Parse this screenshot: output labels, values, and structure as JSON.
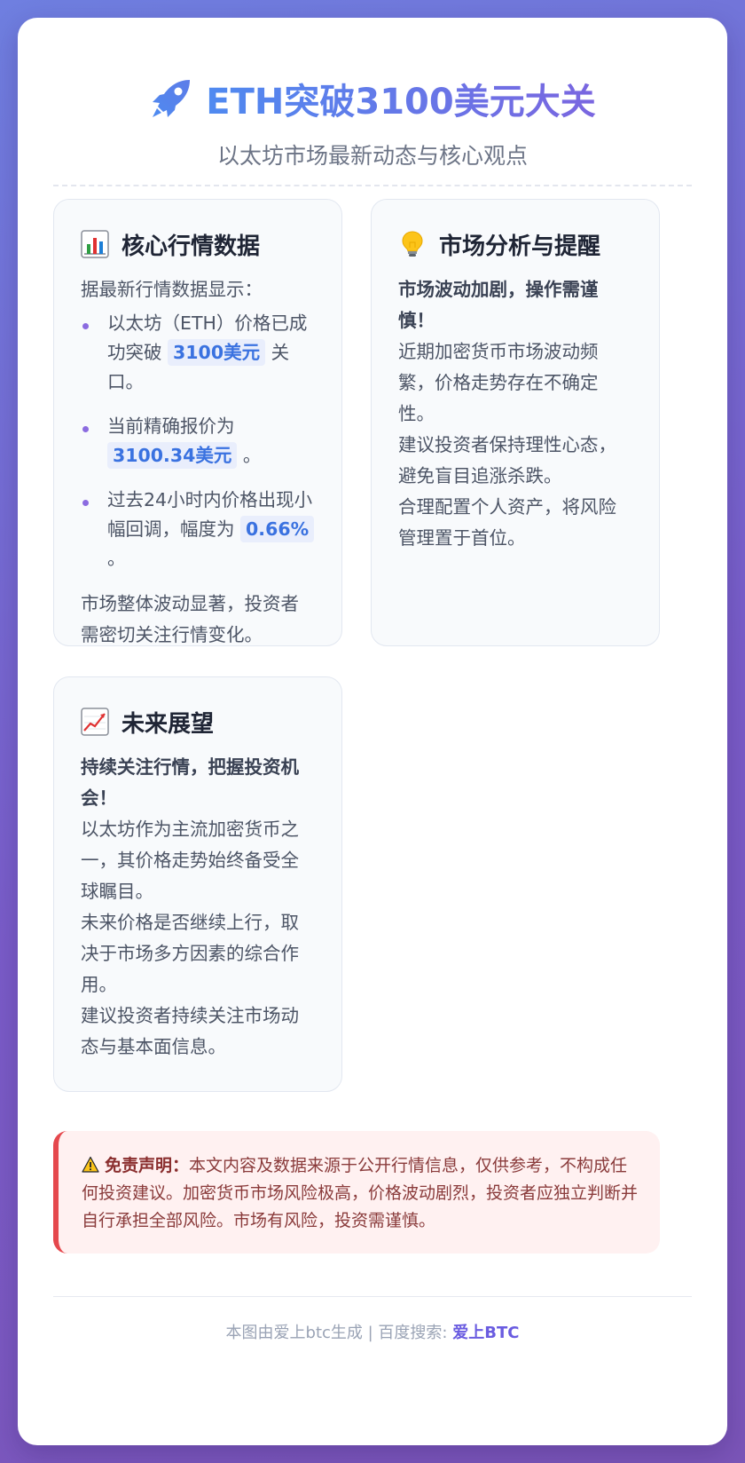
{
  "header": {
    "title": "ETH突破3100美元大关",
    "subtitle": "以太坊市场最新动态与核心观点",
    "title_icon": "rocket-icon",
    "title_gradient": [
      "#4f8af0",
      "#7a66e0"
    ]
  },
  "panels": {
    "market_data": {
      "icon": "bar-chart-icon",
      "title": "核心行情数据",
      "intro": "据最新行情数据显示：",
      "bullets": [
        {
          "before": "以太坊（ETH）价格已成功突破",
          "highlight": "3100美元",
          "after": "关口。"
        },
        {
          "before": "当前精确报价为",
          "highlight": "3100.34美元",
          "after": "。"
        },
        {
          "before": "过去24小时内价格出现小幅回调，幅度为",
          "highlight": "0.66%",
          "after": "。"
        }
      ],
      "outro": "市场整体波动显著，投资者需密切关注行情变化。"
    },
    "analysis": {
      "icon": "lightbulb-icon",
      "title": "市场分析与提醒",
      "headline": "市场波动加剧，操作需谨慎！",
      "lines": [
        "近期加密货币市场波动频繁，价格走势存在不确定性。",
        "建议投资者保持理性心态，避免盲目追涨杀跌。",
        "合理配置个人资产，将风险管理置于首位。"
      ]
    },
    "outlook": {
      "icon": "trend-up-chart-icon",
      "title": "未来展望",
      "headline": "持续关注行情，把握投资机会！",
      "lines": [
        "以太坊作为主流加密货币之一，其价格走势始终备受全球瞩目。",
        "未来价格是否继续上行，取决于市场多方因素的综合作用。",
        "建议投资者持续关注市场动态与基本面信息。"
      ]
    }
  },
  "disclaimer": {
    "icon": "warning-icon",
    "label": "免责声明：",
    "text": "本文内容及数据来源于公开行情信息，仅供参考，不构成任何投资建议。加密货币市场风险极高，价格波动剧烈，投资者应独立判断并自行承担全部风险。市场有风险，投资需谨慎。"
  },
  "footer": {
    "prefix": "本图由爱上btc生成 | 百度搜索: ",
    "brand": "爱上BTC"
  },
  "colors": {
    "accent_blue": "#3a72e0",
    "accent_purple": "#8b6be0",
    "warning_red": "#e5484d",
    "background_gradient": [
      "#6f7fe0",
      "#7b55b8"
    ]
  }
}
